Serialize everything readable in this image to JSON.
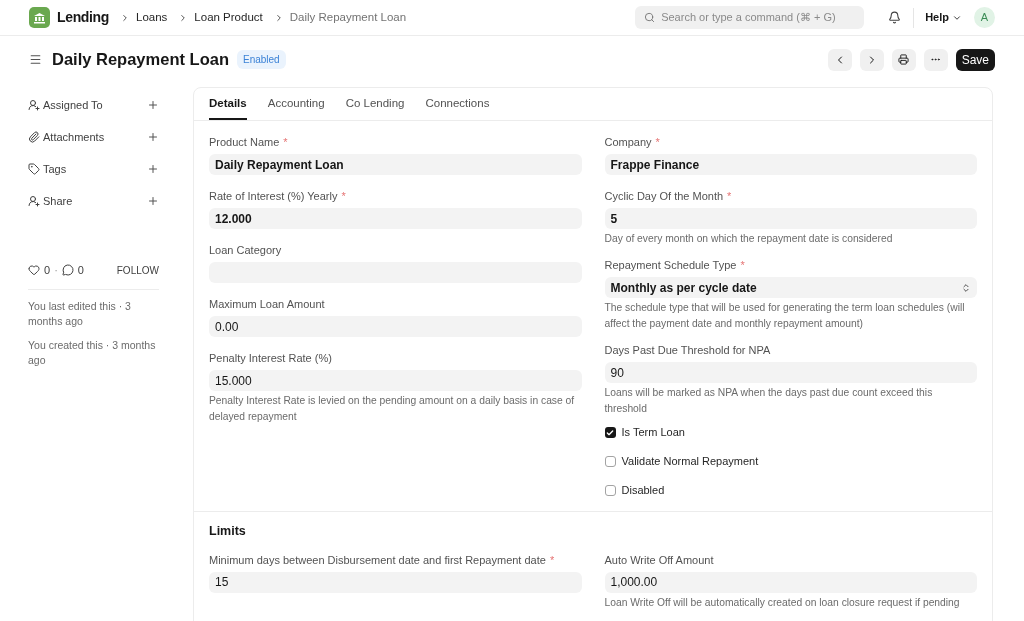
{
  "navbar": {
    "app": "Lending",
    "breadcrumbs": [
      "Loans",
      "Loan Product",
      "Daily Repayment Loan"
    ],
    "search": {
      "placeholder": "Search or type a command (⌘ + G)"
    },
    "help": "Help",
    "avatar": "A"
  },
  "page": {
    "title": "Daily Repayment Loan",
    "status": "Enabled",
    "save": "Save"
  },
  "sidebar": {
    "items": [
      {
        "label": "Assigned To",
        "kind": "user"
      },
      {
        "label": "Attachments",
        "kind": "clip"
      },
      {
        "label": "Tags",
        "kind": "tag"
      },
      {
        "label": "Share",
        "kind": "user"
      }
    ],
    "likes": "0",
    "separator": "·",
    "comments": "0",
    "follow": "FOLLOW",
    "activity": [
      "You last edited this · 3 months ago",
      "You created this · 3 months ago"
    ]
  },
  "tabs": [
    {
      "label": "Details",
      "selected": true
    },
    {
      "label": "Accounting",
      "selected": false
    },
    {
      "label": "Co Lending",
      "selected": false
    },
    {
      "label": "Connections",
      "selected": false
    }
  ],
  "columns": [
    [
      {
        "kind": "input",
        "label": "Product Name",
        "required": "*",
        "value": "Daily Repayment Loan",
        "bold": true
      },
      {
        "kind": "input",
        "label": "Rate of Interest (%) Yearly",
        "required": "*",
        "value": "12.000",
        "bold": true
      },
      {
        "kind": "input",
        "label": "Loan Category"
      },
      {
        "kind": "input",
        "label": "Maximum Loan Amount",
        "value": "0.00",
        "bold": false
      },
      {
        "kind": "input",
        "label": "Penalty Interest Rate (%)",
        "value": "15.000",
        "bold": false,
        "description": "Penalty Interest Rate is levied on the pending amount on a daily basis in case of delayed repayment"
      }
    ],
    [
      {
        "kind": "input",
        "label": "Company",
        "required": "*",
        "value": "Frappe Finance",
        "bold": true
      },
      {
        "kind": "input",
        "label": "Cyclic Day Of the Month",
        "required": "*",
        "value": "5",
        "bold": true,
        "description": "Day of every month on which the repayment date is considered"
      },
      {
        "kind": "select",
        "label": "Repayment Schedule Type",
        "required": "*",
        "value": "Monthly as per cycle date",
        "bold": true,
        "description": "The schedule type that will be used for generating the term loan schedules (will affect the payment date and monthly repayment amount)"
      },
      {
        "kind": "input",
        "label": "Days Past Due Threshold for NPA",
        "value": "90",
        "bold": false,
        "description": "Loans will be marked as NPA when the days past due count exceed this threshold"
      },
      {
        "kind": "check",
        "label": "Is Term Loan",
        "checked": true
      },
      {
        "kind": "check",
        "label": "Validate Normal Repayment",
        "checked": false
      },
      {
        "kind": "check",
        "label": "Disabled",
        "checked": false
      }
    ]
  ],
  "limits": {
    "title": "Limits",
    "columns": [
      [
        {
          "kind": "input",
          "label": "Minimum days between Disbursement date and first Repayment date",
          "required": "*",
          "value": "15",
          "bold": false
        }
      ],
      [
        {
          "kind": "input",
          "label": "Auto Write Off Amount",
          "value": "1,000.00",
          "bold": false,
          "description": "Loan Write Off will be automatically created on loan closure request if pending"
        }
      ]
    ]
  }
}
